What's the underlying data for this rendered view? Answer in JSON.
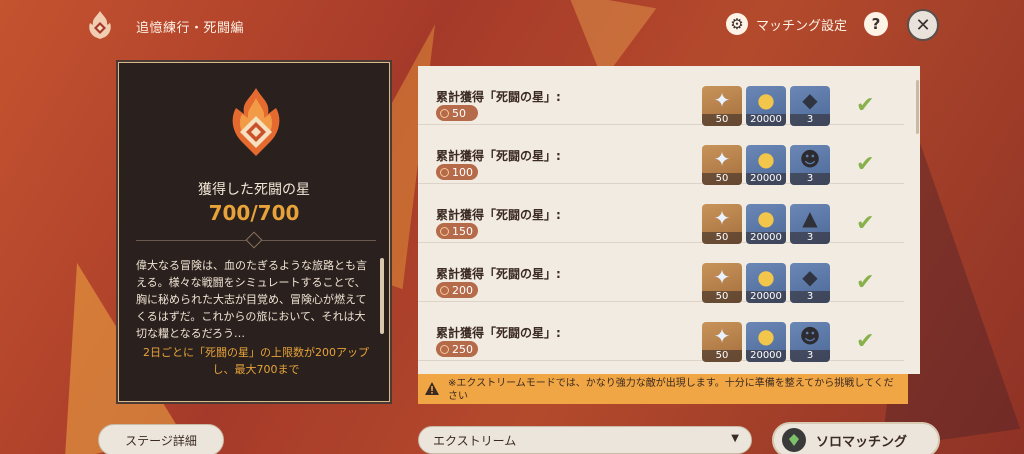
{
  "header": {
    "title": "追憶練行・死闘編",
    "match_settings_label": "マッチング設定",
    "help_label": "?",
    "close_label": "✕"
  },
  "summary": {
    "heading": "獲得した死闘の星",
    "count": "700/700",
    "description": "偉大なる冒険は、血のたぎるような旅路とも言える。様々な戦闘をシミュレートすることで、胸に秘められた大志が目覚め、冒険心が燃えてくるはずだ。これからの旅において、それは大切な糧となるだろう…",
    "note": "2日ごとに「死闘の星」の上限数が200アップし、最大700まで"
  },
  "rewards": {
    "rows": [
      {
        "label": "累計獲得「死闘の星」:",
        "threshold": "50",
        "items": [
          {
            "icon": "primogem-icon",
            "qty": "50"
          },
          {
            "icon": "mora-icon",
            "qty": "20000"
          },
          {
            "icon": "ore-icon",
            "qty": "3"
          }
        ]
      },
      {
        "label": "累計獲得「死闘の星」:",
        "threshold": "100",
        "items": [
          {
            "icon": "primogem-icon",
            "qty": "50"
          },
          {
            "icon": "mora-icon",
            "qty": "20000"
          },
          {
            "icon": "mask-icon",
            "qty": "3"
          }
        ]
      },
      {
        "label": "累計獲得「死闘の星」:",
        "threshold": "150",
        "items": [
          {
            "icon": "primogem-icon",
            "qty": "50"
          },
          {
            "icon": "mora-icon",
            "qty": "20000"
          },
          {
            "icon": "horn-icon",
            "qty": "3"
          }
        ]
      },
      {
        "label": "累計獲得「死闘の星」:",
        "threshold": "200",
        "items": [
          {
            "icon": "primogem-icon",
            "qty": "50"
          },
          {
            "icon": "mora-icon",
            "qty": "20000"
          },
          {
            "icon": "ore-icon",
            "qty": "3"
          }
        ]
      },
      {
        "label": "累計獲得「死闘の星」:",
        "threshold": "250",
        "items": [
          {
            "icon": "primogem-icon",
            "qty": "50"
          },
          {
            "icon": "mora-icon",
            "qty": "20000"
          },
          {
            "icon": "mask-icon",
            "qty": "3"
          }
        ]
      }
    ],
    "claimed_icon": "checkmark-icon"
  },
  "warning": {
    "text": "※エクストリームモードでは、かなり強力な敵が出現します。十分に準備を整えてから挑戦してください"
  },
  "controls": {
    "stage_details_label": "ステージ詳細",
    "mode_value": "エクストリーム",
    "solo_match_label": "ソロマッチング"
  },
  "colors": {
    "accent_orange": "#e7a33a",
    "check_green": "#88b04b",
    "warning_bg": "#f0a644"
  }
}
